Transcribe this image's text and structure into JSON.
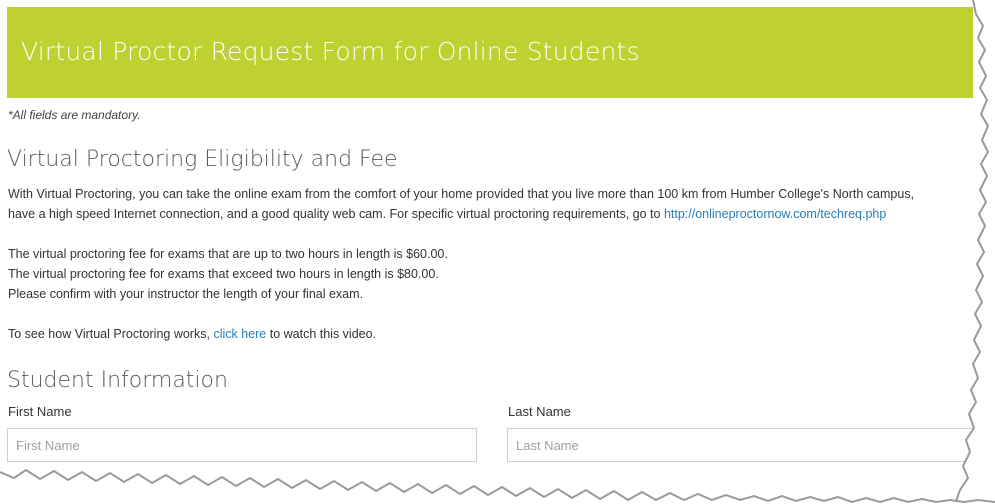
{
  "header": {
    "title": "Virtual Proctor Request Form for Online Students"
  },
  "mandatory_note": "*All fields are mandatory.",
  "eligibility": {
    "heading": "Virtual Proctoring Eligibility and Fee",
    "intro_line1": "With Virtual Proctoring, you can take the online exam from the comfort of your home provided that you live more than 100 km from Humber College's North campus,",
    "intro_line2_text": "have a high speed Internet connection, and a good quality web cam. For specific virtual proctoring requirements, go to",
    "requirements_link": "http://onlineproctornow.com/techreq.php",
    "fee_line1": "The virtual proctoring fee for exams that are up to two hours in length is $60.00.",
    "fee_line2": "The virtual proctoring fee for exams that exceed two hours in length is $80.00.",
    "fee_line3": "Please confirm with your instructor the length of your final exam.",
    "video_prefix": "To see how Virtual Proctoring works,",
    "video_link": "click here",
    "video_suffix": "to watch this video."
  },
  "student_info": {
    "heading": "Student Information",
    "first_name": {
      "label": "First Name",
      "placeholder": "First Name",
      "value": ""
    },
    "last_name": {
      "label": "Last Name",
      "placeholder": "Last Name",
      "value": ""
    }
  },
  "colors": {
    "banner": "#bed131",
    "link": "#2a7cb4"
  }
}
